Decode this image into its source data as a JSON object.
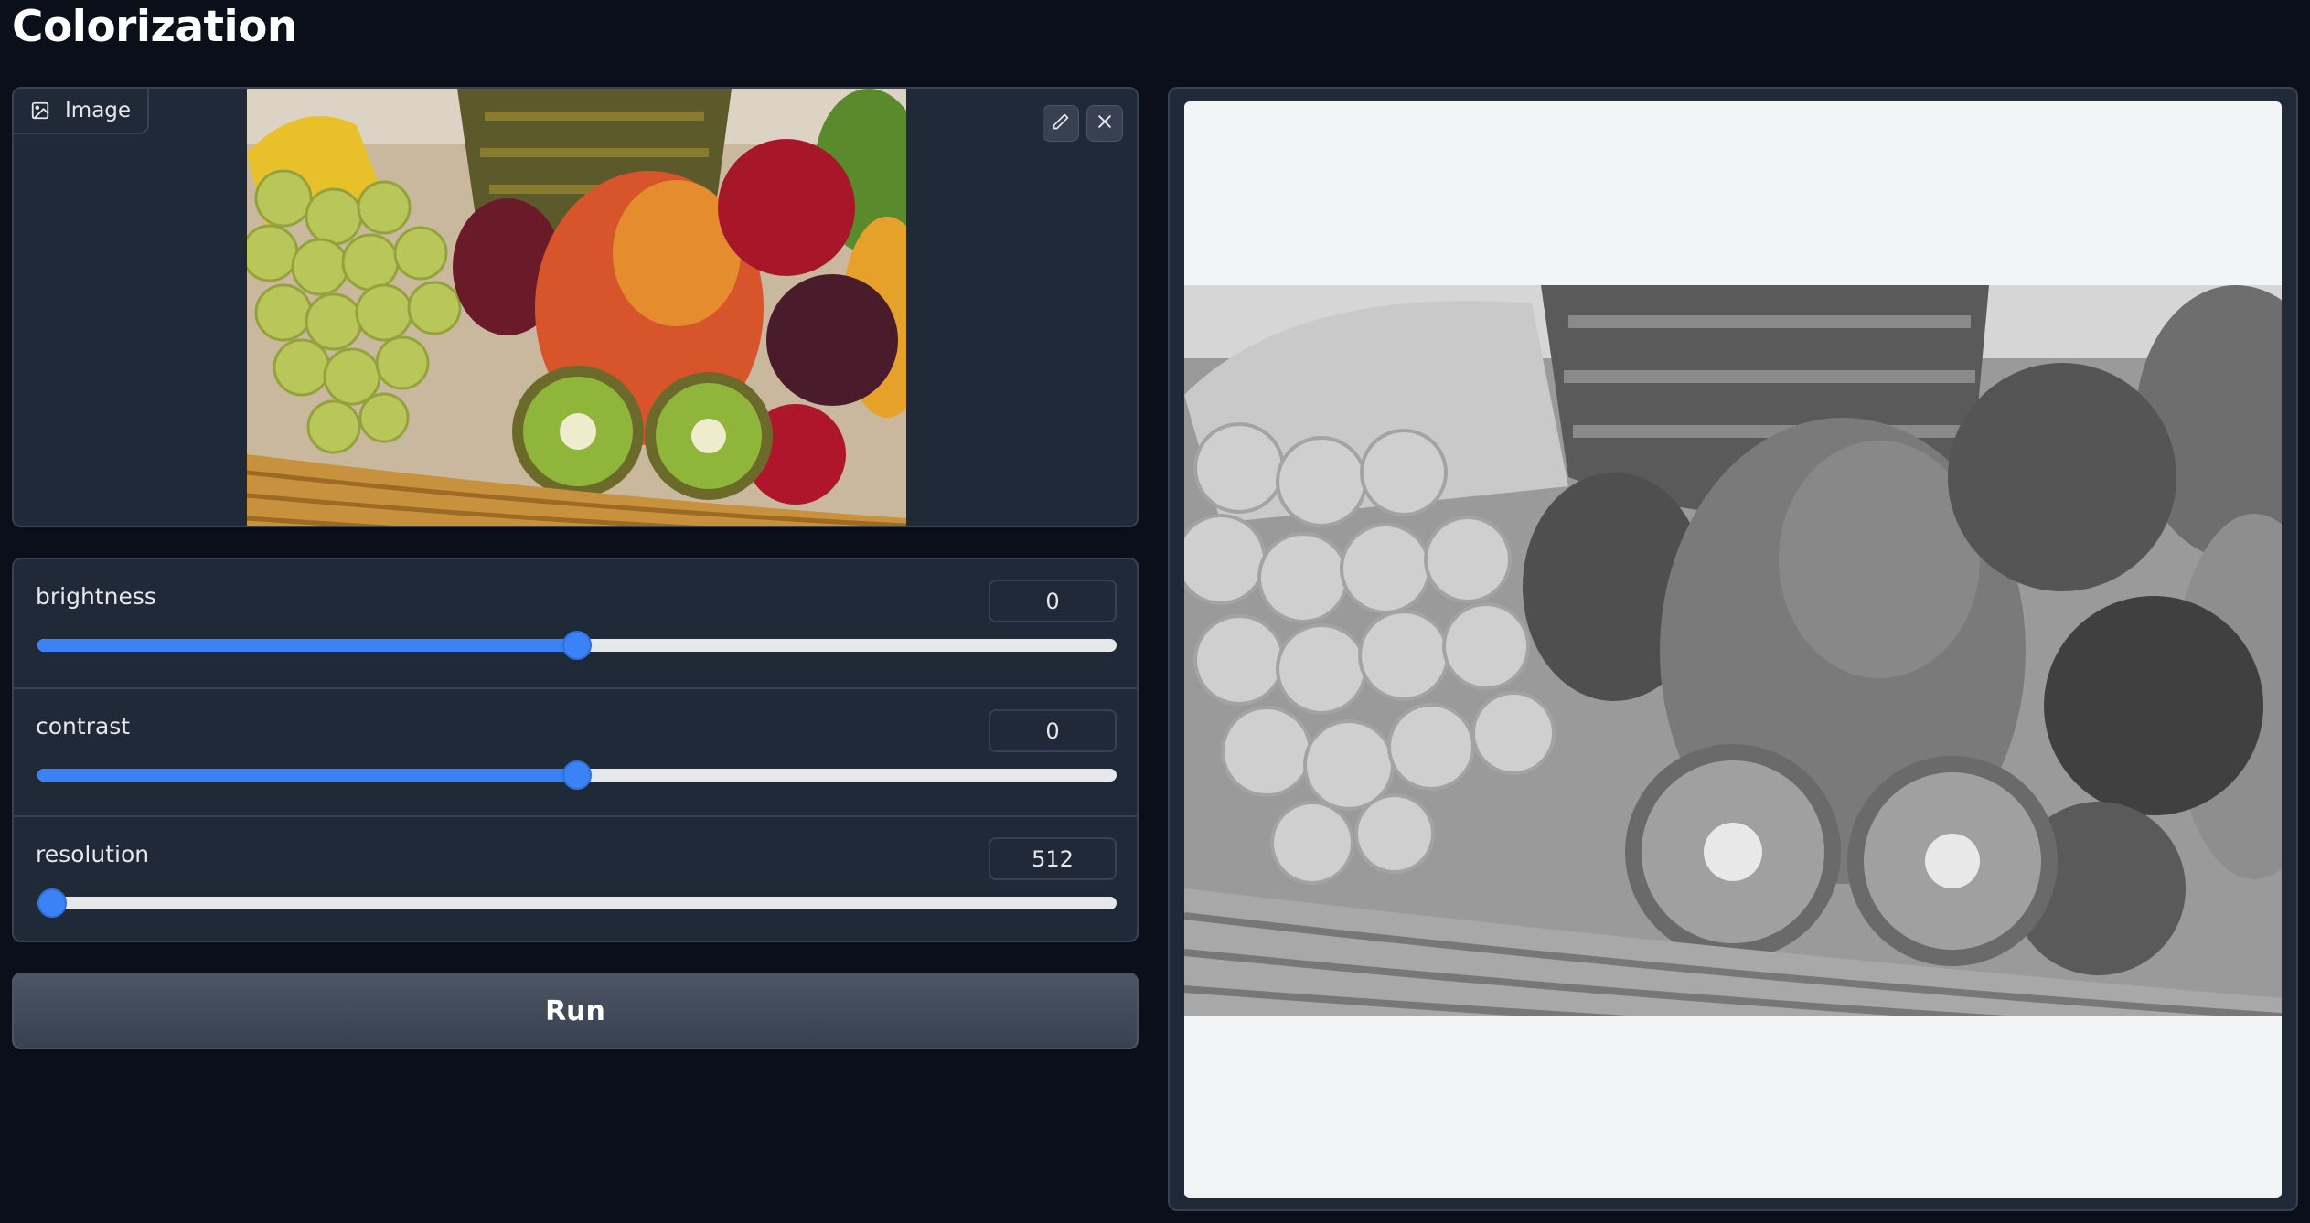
{
  "page": {
    "title": "Colorization"
  },
  "image_input": {
    "label": "Image",
    "label_icon": "image-icon",
    "actions": [
      {
        "icon": "pencil-icon",
        "name": "edit"
      },
      {
        "icon": "close-icon",
        "name": "clear"
      }
    ]
  },
  "sliders": [
    {
      "label": "brightness",
      "value": "0",
      "fraction": 0.5
    },
    {
      "label": "contrast",
      "value": "0",
      "fraction": 0.5
    },
    {
      "label": "resolution",
      "value": "512",
      "fraction": 0.0
    }
  ],
  "run_button": {
    "label": "Run"
  },
  "colors": {
    "background": "#0b0f19",
    "panel": "#1f2937",
    "border": "#374151",
    "accent": "#3b82f6",
    "output_background": "#f3f4f6"
  }
}
